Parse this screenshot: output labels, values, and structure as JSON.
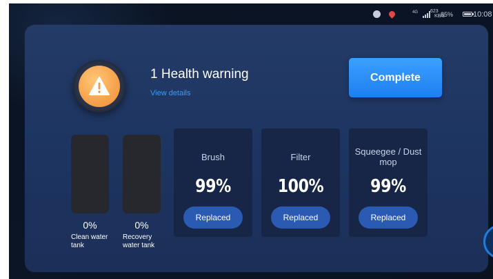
{
  "status_bar": {
    "signal_label": "4G",
    "net_speed_value": "623",
    "net_speed_unit": "KB/s",
    "battery_percent": "85%",
    "battery_level": 0.85,
    "time": "10:08"
  },
  "header": {
    "title": "1 Health warning",
    "link": "View details",
    "complete_button": "Complete"
  },
  "tanks": [
    {
      "percent": "0%",
      "label": "Clean water tank"
    },
    {
      "percent": "0%",
      "label": "Recovery water tank"
    }
  ],
  "parts": [
    {
      "name": "Brush",
      "percent": "99%",
      "button": "Replaced"
    },
    {
      "name": "Filter",
      "percent": "100%",
      "button": "Replaced"
    },
    {
      "name": "Squeegee / Dust mop",
      "percent": "99%",
      "button": "Replaced"
    }
  ],
  "colors": {
    "accent": "#1e7ff0",
    "warning": "#f7a24d",
    "panel": "#213862"
  }
}
